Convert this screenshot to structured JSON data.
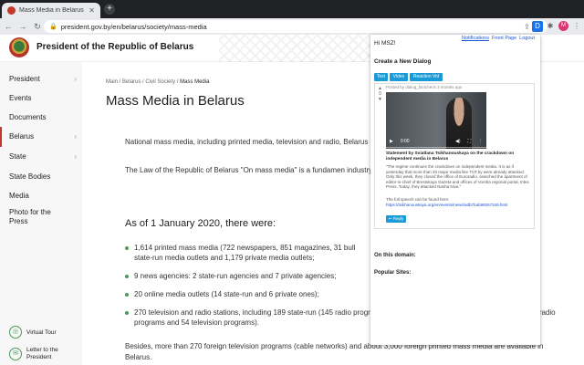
{
  "browser": {
    "tab_title": "Mass Media in Belarus | Offici",
    "url": "president.gov.by/en/belarus/society/mass-media",
    "new_tab": "+",
    "profile_initial": "M"
  },
  "site": {
    "title": "President of the Republic of Belarus"
  },
  "sidebar": {
    "items": [
      {
        "label": "President",
        "chevron": "›"
      },
      {
        "label": "Events",
        "chevron": ""
      },
      {
        "label": "Documents",
        "chevron": ""
      },
      {
        "label": "Belarus",
        "chevron": "›"
      },
      {
        "label": "State",
        "chevron": "›"
      },
      {
        "label": "State Bodies",
        "chevron": ""
      },
      {
        "label": "Media",
        "chevron": ""
      },
      {
        "label": "Photo for the Press",
        "chevron": ""
      }
    ],
    "bottom": [
      {
        "label": "Virtual Tour"
      },
      {
        "label": "Letter to the President"
      }
    ]
  },
  "main": {
    "breadcrumb": [
      "Main",
      "Belarus",
      "Civil Society"
    ],
    "breadcrumb_current": "Mass Media",
    "title": "Mass Media in Belarus",
    "para1": "National mass media, including printed media, television and radio, Belarus",
    "para2": "The Law of the Republic of Belarus \"On mass media\" is a fundamen industry.",
    "as_of": "As of 1 January 2020, there were:",
    "bullets": [
      "1,614 printed mass media (722 newspapers, 851 magazines, 31 bull state-run media outlets and 1,179 private media outlets;",
      "9 news agencies: 2 state-run agencies and 7 private agencies;",
      "20 online media outlets (14 state-run and 6 private ones);",
      "270 television and radio stations, including 189 state-run (145 radio programs and 44 television programs) and 81 private (27 radio programs and 54 television programs)."
    ],
    "besides": "Besides, more than 270 foreign television programs (cable networks) and about 3,000 foreign printed mass media are available in Belarus."
  },
  "popup": {
    "greeting": "Hi MSZ!",
    "links": [
      "Notifications",
      "Front Page",
      "Logout"
    ],
    "create_heading": "Create a New Dialog",
    "buttons": [
      "Text",
      "Video",
      "Reaction Vid"
    ],
    "vote_up": "▲",
    "vote_count": "0",
    "vote_down": "▼",
    "post_meta": "Posted by dialog_factcheck 3 months ago",
    "video_time": "0:00",
    "post_title": "Statement by Sviatlana Tsikhanouskaya on the crackdown on independent media in Belarus",
    "post_text": "\"The regime continues the crackdown on independent media. It is as if yesterday that more than 20 major media like TUT.by were already attacked. Only this week, they closed the office of Euroradio, searched the apartment of editor-in-chief of Brestskaya Gazeta and offices of Vorsha regional portal, Intex Press. Today, they attacked Nasha Niva.\"",
    "post_text2": "The full speech can be found here:",
    "post_link": "https://tsikhanouskaya.org/en/events/news/adb7bab99267349.html",
    "reply_label": "Reply",
    "on_domain": "On this domain:",
    "popular_sites": "Popular Sites:"
  }
}
